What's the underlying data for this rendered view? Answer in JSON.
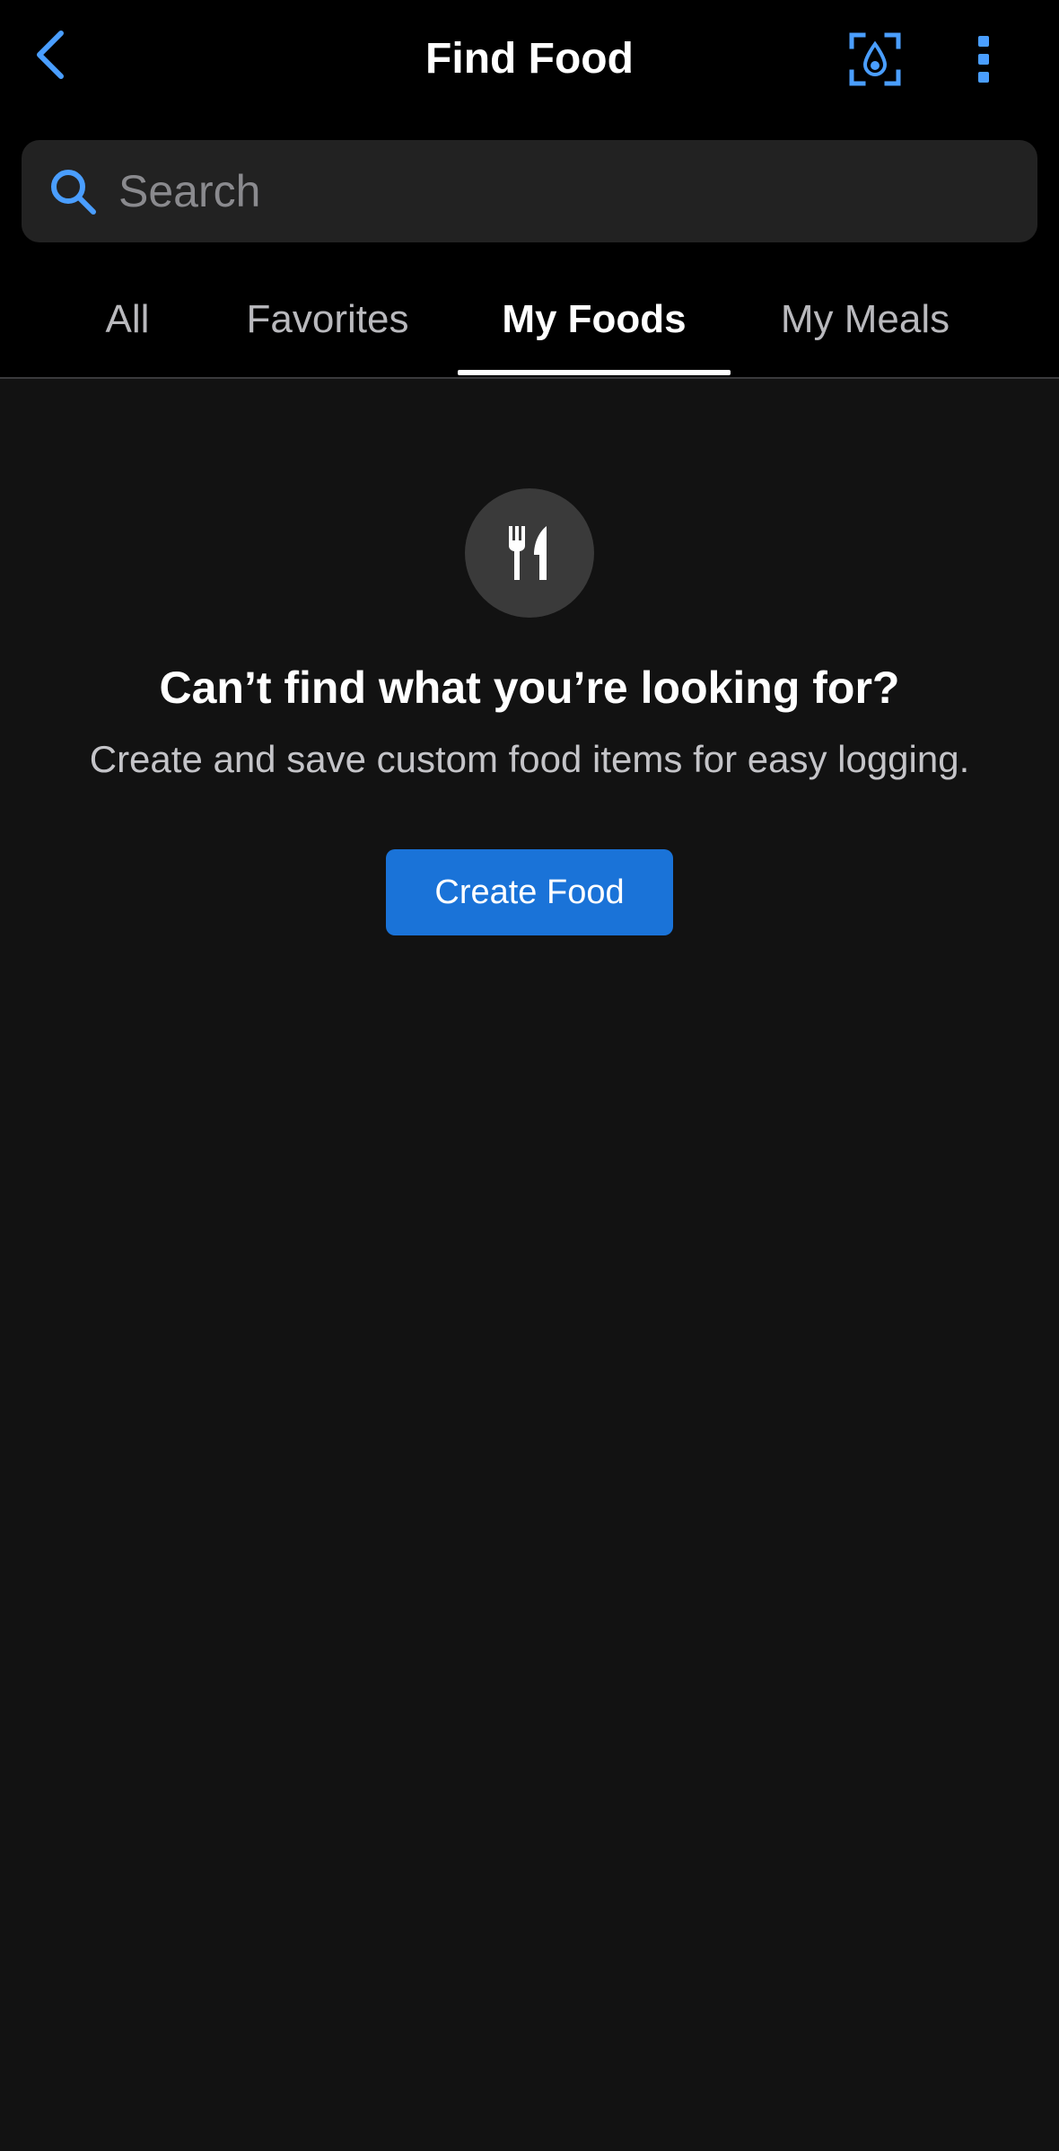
{
  "header": {
    "title": "Find Food",
    "back_icon": "chevron-left-icon",
    "scan_icon": "barcode-scan-icon",
    "more_icon": "more-vertical-icon"
  },
  "search": {
    "placeholder": "Search",
    "value": "",
    "icon": "search-icon"
  },
  "tabs": [
    {
      "label": "All",
      "active": false
    },
    {
      "label": "Favorites",
      "active": false
    },
    {
      "label": "My Foods",
      "active": true
    },
    {
      "label": "My Meals",
      "active": false
    }
  ],
  "empty_state": {
    "icon": "fork-knife-icon",
    "title": "Can’t find what you’re looking for?",
    "subtitle": "Create and save custom food items for easy logging.",
    "button_label": "Create Food"
  },
  "colors": {
    "background": "#121212",
    "header_background": "#000000",
    "accent": "#4a9eff",
    "button": "#1a73d8",
    "search_background": "#222222"
  }
}
